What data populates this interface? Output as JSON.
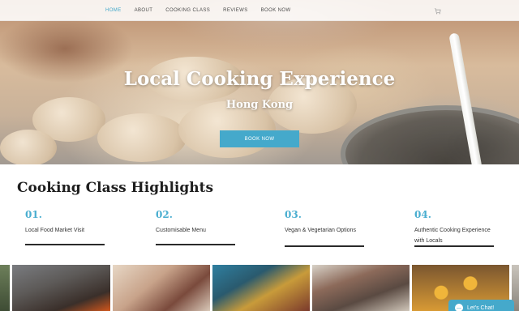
{
  "nav": {
    "items": [
      {
        "label": "HOME",
        "active": true
      },
      {
        "label": "ABOUT",
        "active": false
      },
      {
        "label": "COOKING CLASS",
        "active": false
      },
      {
        "label": "REVIEWS",
        "active": false
      },
      {
        "label": "BOOK NOW",
        "active": false
      }
    ],
    "cart_icon": "cart-icon"
  },
  "hero": {
    "title": "Local Cooking Experience",
    "subtitle": "Hong Kong",
    "button_label": "BOOK NOW"
  },
  "highlights": {
    "title": "Cooking Class Highlights",
    "items": [
      {
        "number": "01.",
        "text": "Local Food Market Visit"
      },
      {
        "number": "02.",
        "text": "Customisable Menu"
      },
      {
        "number": "03.",
        "text": "Vegan & Vegetarian Options"
      },
      {
        "number": "04.",
        "text": "Authentic Cooking Experience with Locals"
      }
    ]
  },
  "chat": {
    "label": "Let's Chat!"
  },
  "colors": {
    "accent": "#45a9cb",
    "nav_active": "#3fa6c9",
    "heading": "#1e1e1e"
  }
}
